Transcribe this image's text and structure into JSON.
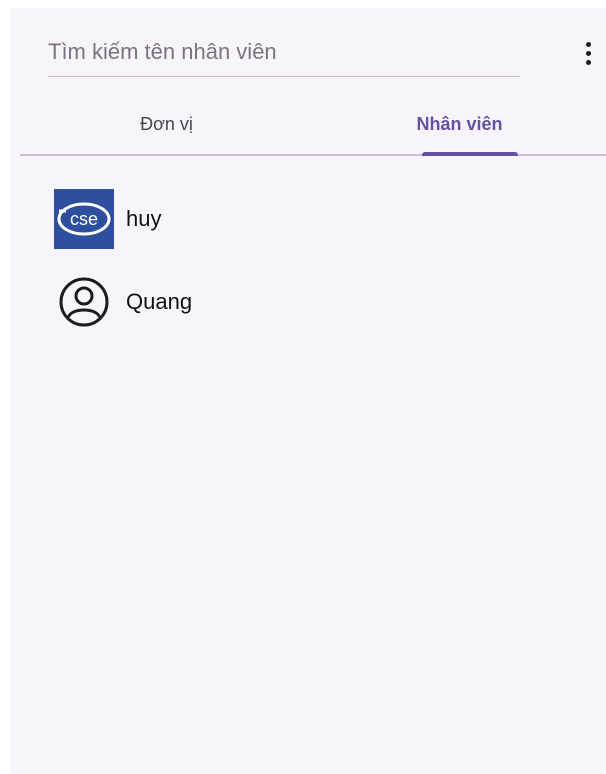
{
  "search": {
    "placeholder": "Tìm kiếm tên nhân viên",
    "value": ""
  },
  "menu": {
    "icon": "more-vert-icon"
  },
  "tabs": [
    {
      "label": "Đơn vị",
      "selected": false
    },
    {
      "label": "Nhân viên",
      "selected": true
    }
  ],
  "employees": [
    {
      "name": "huy",
      "avatar": "cse-logo",
      "logo_text": "cse"
    },
    {
      "name": "Quang",
      "avatar": "account-circle-icon"
    }
  ],
  "colors": {
    "accent": "#6750a4",
    "background": "#f8f4fb",
    "logo_bg": "#2e4f9e"
  }
}
